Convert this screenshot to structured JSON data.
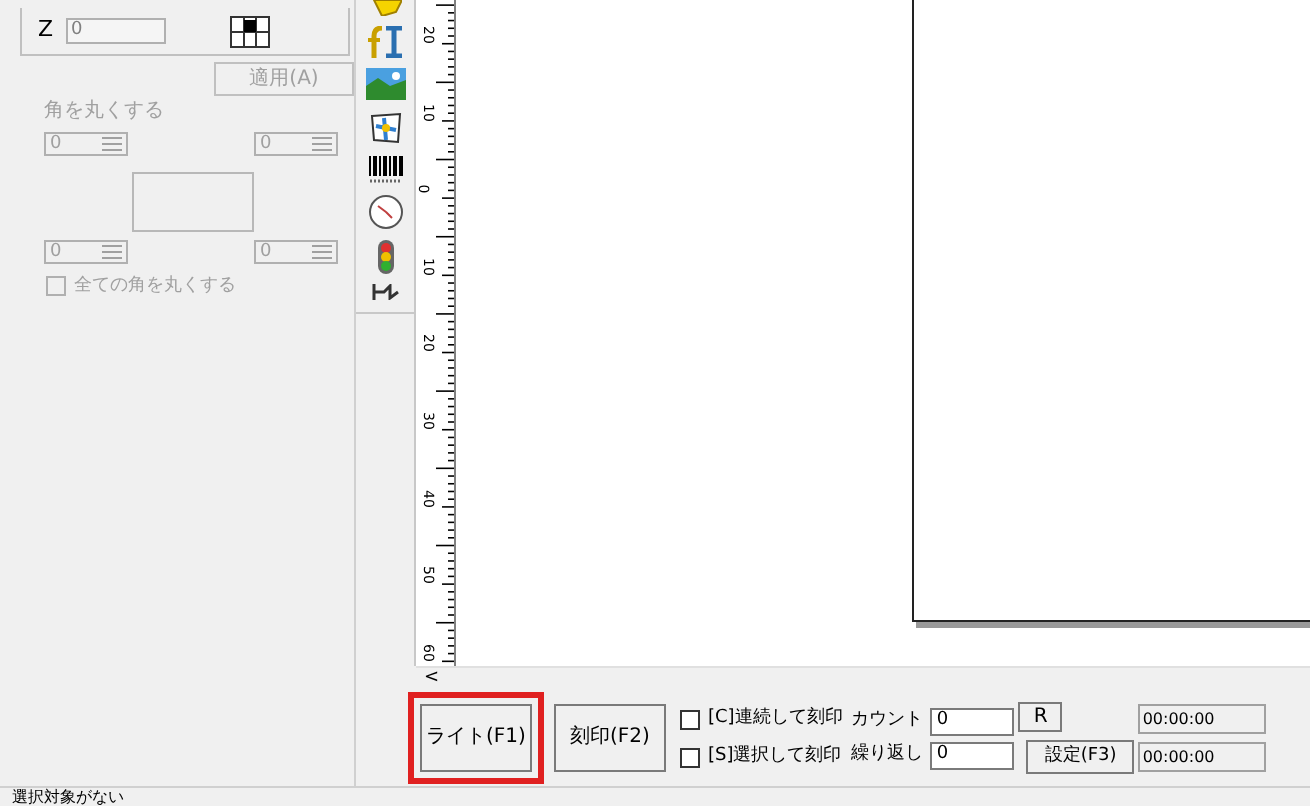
{
  "left_panel": {
    "z_label": "Z",
    "z_value": "0",
    "apply_button": {
      "label": "適用(A)",
      "disabled": true
    },
    "round_corners": {
      "label": "角を丸くする",
      "disabled": true,
      "spinners": [
        {
          "value": "0"
        },
        {
          "value": "0"
        },
        {
          "value": "0"
        },
        {
          "value": "0"
        }
      ],
      "all_corners": {
        "label": "全ての角を丸くする",
        "checked": false
      }
    }
  },
  "ruler": {
    "labels": [
      "20",
      "10",
      "0",
      "10",
      "20",
      "30",
      "40",
      "50",
      "60"
    ]
  },
  "scrollbar": {
    "arrow": "<"
  },
  "controls": {
    "buttons": [
      {
        "label": "ライト(F1)",
        "highlighted": true
      },
      {
        "label": "刻印(F2)",
        "highlighted": false
      }
    ],
    "options": [
      {
        "label": "[C]連続して刻印",
        "checked": false
      },
      {
        "label": "[S]選択して刻印",
        "checked": false
      }
    ],
    "count": {
      "label": "カウント",
      "value": "0"
    },
    "repeat": {
      "label": "繰り返し",
      "value": "0"
    },
    "reset_button": "R",
    "settings_button": "設定(F3)",
    "timers": [
      "00:00:00",
      "00:00:00"
    ]
  },
  "status_bar": {
    "text": "選択対象がない"
  }
}
